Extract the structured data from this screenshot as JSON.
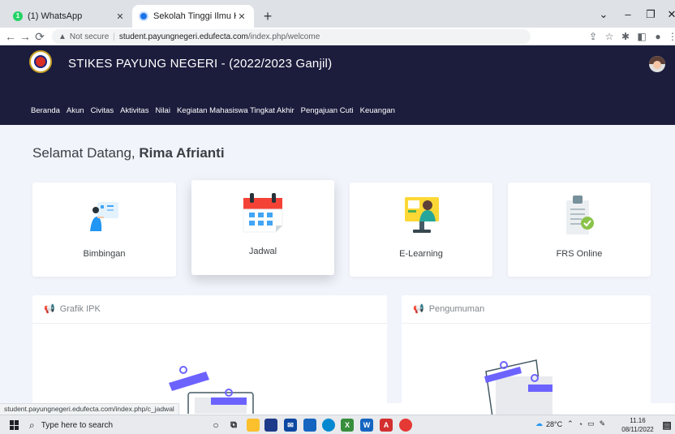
{
  "browser": {
    "tabs": [
      {
        "title": "(1) WhatsApp",
        "icon": "whatsapp-icon",
        "active": false
      },
      {
        "title": "Sekolah Tinggi Ilmu Kesehatan P",
        "icon": "site-favicon-icon",
        "active": true
      }
    ],
    "address": {
      "security_label": "Not secure",
      "host": "student.payungnegeri.edufecta.com",
      "path": "/index.php/welcome"
    },
    "status_url": "student.payungnegeri.edufecta.com/index.php/c_jadwal"
  },
  "site": {
    "title": "STIKES PAYUNG NEGERI - (2022/2023 Ganjil)",
    "nav": [
      "Beranda",
      "Akun",
      "Civitas",
      "Aktivitas",
      "Nilai",
      "Kegiatan Mahasiswa Tingkat Akhir",
      "Pengajuan Cuti",
      "Keuangan"
    ]
  },
  "main": {
    "welcome_prefix": "Selamat Datang,",
    "user_name": "Rima Afrianti",
    "cards": [
      {
        "label": "Bimbingan",
        "icon": "consultation-icon"
      },
      {
        "label": "Jadwal",
        "icon": "calendar-icon"
      },
      {
        "label": "E-Learning",
        "icon": "e-learning-icon"
      },
      {
        "label": "FRS Online",
        "icon": "clipboard-check-icon"
      }
    ],
    "panels": [
      {
        "title": "Grafik IPK",
        "icon": "megaphone-icon"
      },
      {
        "title": "Pengumuman",
        "icon": "megaphone-icon"
      }
    ]
  },
  "taskbar": {
    "search_placeholder": "Type here to search",
    "weather": "28°C",
    "time": "11.16",
    "date": "08/11/2022"
  },
  "colors": {
    "header_bg": "#1c1d3d",
    "page_bg": "#f1f4fb",
    "accent_purple": "#6c63ff",
    "calendar_red": "#f44336"
  }
}
